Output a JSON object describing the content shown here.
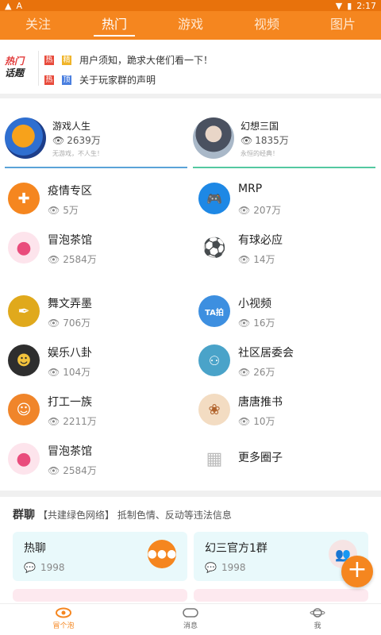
{
  "status": {
    "time": "2:17"
  },
  "topnav": {
    "tabs": [
      "关注",
      "热门",
      "游戏",
      "视频",
      "图片"
    ]
  },
  "hot": {
    "badge_line1": "热门",
    "badge_line2": "话题",
    "items": [
      {
        "tag1": "热",
        "tag2": "精",
        "text": "用户须知，跪求大佬们看一下！"
      },
      {
        "tag1": "热",
        "tag2": "顶",
        "text": "关于玩家群的声明"
      }
    ]
  },
  "featured": [
    {
      "name": "游戏人生",
      "count": "2639万",
      "slogan": "无游戏，不人生！",
      "line_color": "#5aa3d8"
    },
    {
      "name": "幻想三国",
      "count": "1835万",
      "slogan": "永恒的经典！",
      "line_color": "#54c8a0"
    }
  ],
  "groups": [
    {
      "name": "疫情专区",
      "count": "5万",
      "icon": "medkit-icon",
      "color": "#f5861f"
    },
    {
      "name": "MRP",
      "count": "207万",
      "icon": "gamepad-icon",
      "color": "#1e88e5"
    },
    {
      "name": "冒泡茶馆",
      "count": "2584万",
      "icon": "teapot-icon",
      "color": "#e94c7c"
    },
    {
      "name": "有球必应",
      "count": "14万",
      "icon": "soccer-ball-icon",
      "color": "#333333"
    },
    {
      "name": "舞文弄墨",
      "count": "706万",
      "icon": "quill-icon",
      "color": "#e0a91c"
    },
    {
      "name": "小视频",
      "count": "16万",
      "icon": "camera-icon",
      "color": "#3d8fe0"
    },
    {
      "name": "娱乐八卦",
      "count": "104万",
      "icon": "mask-icon",
      "color": "#444444"
    },
    {
      "name": "社区居委会",
      "count": "26万",
      "icon": "community-icon",
      "color": "#4aa3c9"
    },
    {
      "name": "打工一族",
      "count": "2211万",
      "icon": "worker-icon",
      "color": "#f0852a"
    },
    {
      "name": "唐唐推书",
      "count": "10万",
      "icon": "book-avatar-icon",
      "color": "#d9a05b"
    },
    {
      "name": "冒泡茶馆",
      "count": "2584万",
      "icon": "teapot-icon",
      "color": "#e94c7c"
    },
    {
      "name": "更多圈子",
      "count": "",
      "icon": "grid-icon",
      "color": "#bbbbbb"
    }
  ],
  "group_chat": {
    "title": "群聊",
    "subtitle": "【共建绿色网络】 抵制色情、反动等违法信息",
    "cards": [
      {
        "name": "热聊",
        "count": "1998",
        "bg": "#e9f9fb",
        "icon": "chat-bubble-icon"
      },
      {
        "name": "幻三官方1群",
        "count": "1998",
        "bg": "#e9f9fb",
        "icon": "avatar-pair-icon"
      }
    ]
  },
  "bottom_nav": [
    {
      "label": "冒个泡",
      "icon": "eye-icon",
      "active": true
    },
    {
      "label": "消息",
      "icon": "gamepad-outline-icon",
      "active": false
    },
    {
      "label": "我",
      "icon": "planet-icon",
      "active": false
    }
  ]
}
